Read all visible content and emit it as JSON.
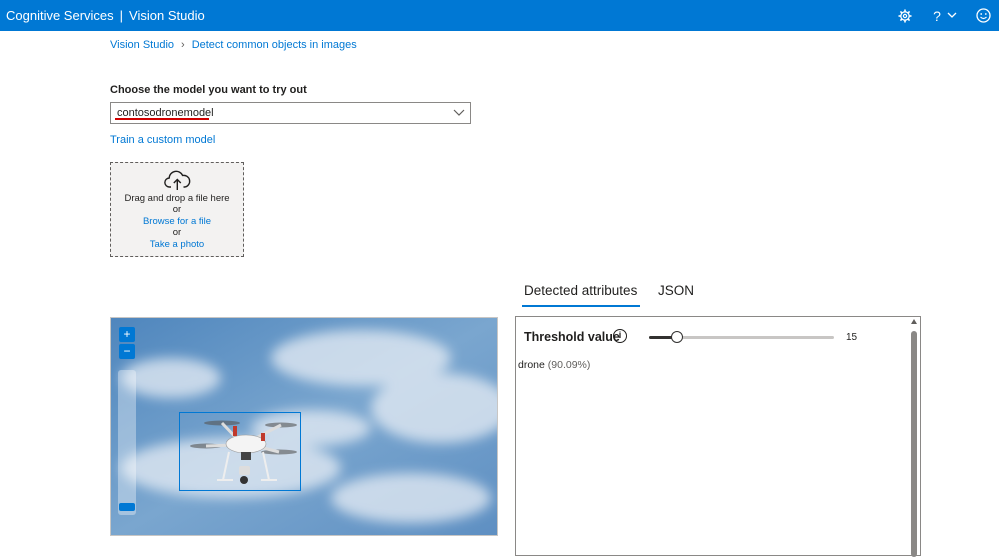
{
  "header": {
    "product": "Cognitive Services",
    "separator": "|",
    "app": "Vision Studio",
    "icons": [
      "gear-icon",
      "help-icon",
      "chevron-down-icon",
      "smiley-icon"
    ],
    "help_glyph": "?"
  },
  "breadcrumb": {
    "items": [
      "Vision Studio",
      "Detect common objects in images"
    ]
  },
  "model": {
    "label": "Choose the model you want to try out",
    "selected": "contosodronemodel",
    "train_link": "Train a custom model"
  },
  "upload": {
    "drag_text": "Drag and drop a file here",
    "or1": "or",
    "browse": "Browse for a file",
    "or2": "or",
    "photo": "Take a photo"
  },
  "tabs": [
    {
      "label": "Detected attributes",
      "active": true
    },
    {
      "label": "JSON",
      "active": false
    }
  ],
  "zoom": {
    "plus": "+",
    "minus": "−"
  },
  "threshold": {
    "label": "Threshold value",
    "info": "i",
    "value": 15,
    "value_text": "15",
    "min": 0,
    "max": 100
  },
  "results": [
    {
      "label": "drone",
      "confidence": "(90.09%)"
    }
  ],
  "colors": {
    "accent": "#0078d4",
    "underline": "#d10000"
  }
}
